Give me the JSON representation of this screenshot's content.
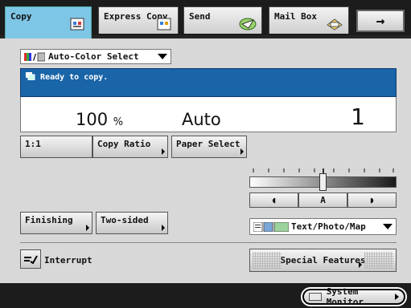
{
  "tabs": [
    {
      "label": "Copy",
      "icon": "copy-icon",
      "active": true
    },
    {
      "label": "Express Copy",
      "icon": "express-copy-icon",
      "active": false
    },
    {
      "label": "Send",
      "icon": "send-icon",
      "active": false
    },
    {
      "label": "Mail Box",
      "icon": "mailbox-icon",
      "active": false
    }
  ],
  "arrow_button": {
    "icon": "right-arrow-icon",
    "glyph": "→"
  },
  "color_select": {
    "value": "Auto-Color Select",
    "icon": "color-mode-icon"
  },
  "status": {
    "message": "Ready to copy.",
    "icon": "copy-status-icon"
  },
  "readout": {
    "ratio": "100",
    "ratio_unit": "%",
    "paper": "Auto",
    "quantity": "1"
  },
  "buttons": {
    "one_to_one": "1:1",
    "copy_ratio": "Copy Ratio",
    "paper_select": "Paper Select",
    "finishing": "Finishing",
    "two_sided": "Two-sided",
    "interrupt": "Interrupt",
    "special_features": "Special Features"
  },
  "density": {
    "light_glyph": "◖",
    "auto_label": "A",
    "dark_glyph": "◗",
    "level": 0.5
  },
  "mode_select": {
    "value": "Text/Photo/Map"
  },
  "system_monitor": {
    "label": "System Monitor"
  },
  "colors": {
    "tab_active": "#7ec6e6",
    "status_bg": "#1a64a8",
    "panel_bg": "#d8d8d8",
    "frame_bg": "#1c1c1c"
  }
}
